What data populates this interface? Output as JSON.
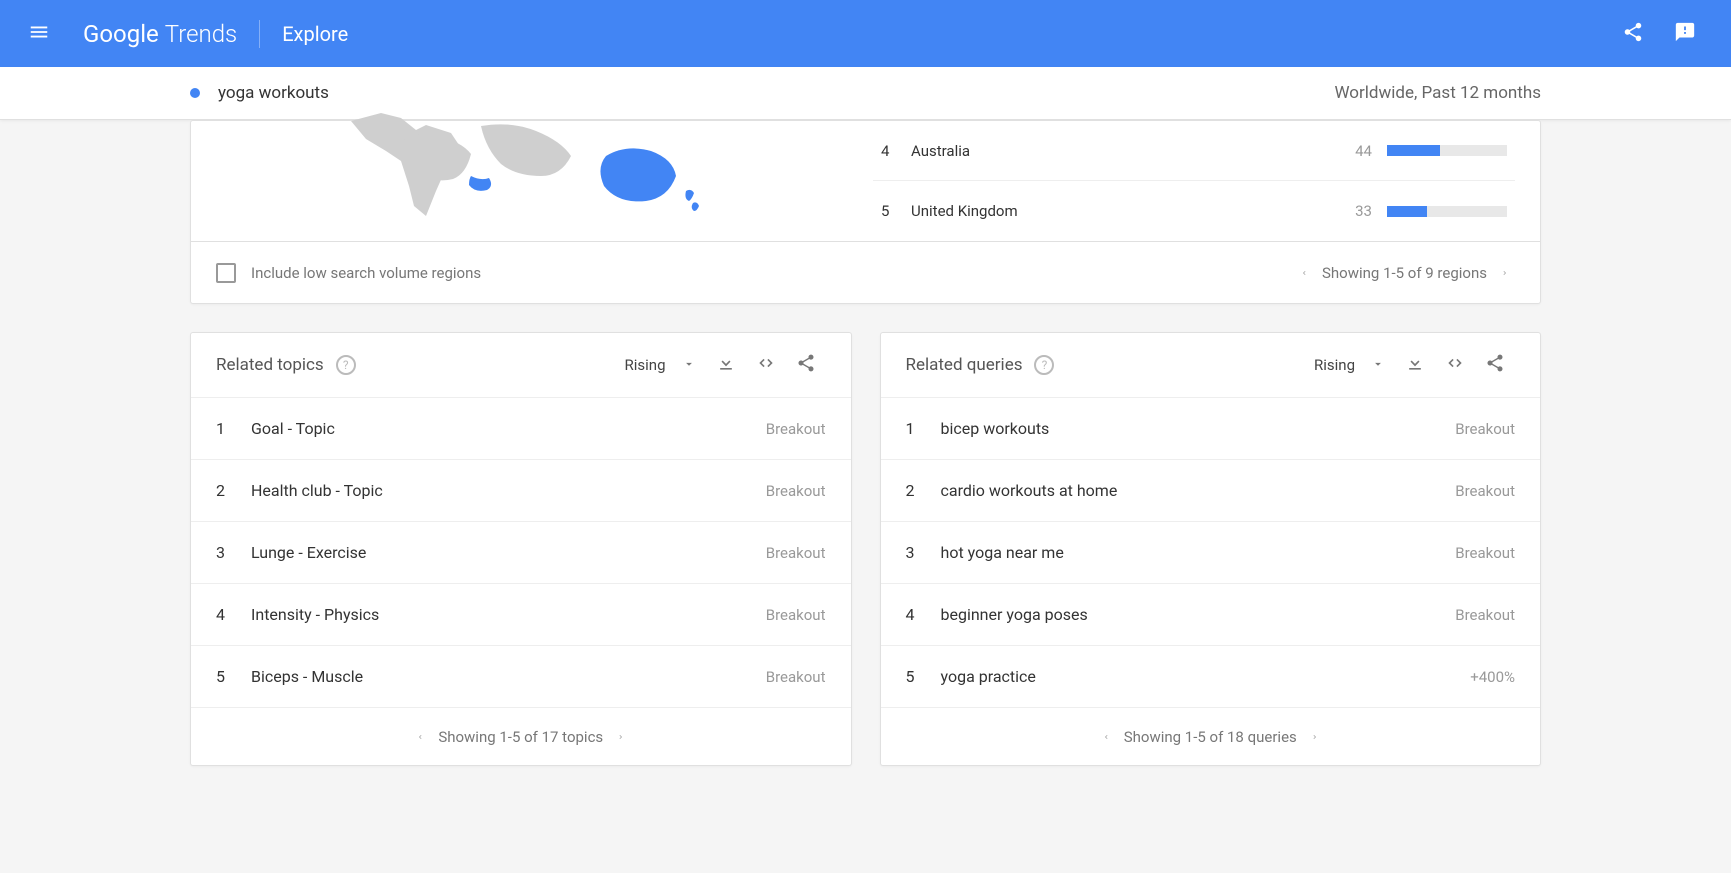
{
  "header": {
    "logo_google": "Google",
    "logo_trends": "Trends",
    "explore": "Explore"
  },
  "subheader": {
    "term": "yoga workouts",
    "context": "Worldwide, Past 12 months"
  },
  "regions_card": {
    "items": [
      {
        "rank": "4",
        "name": "Australia",
        "value": "44",
        "width": "44%"
      },
      {
        "rank": "5",
        "name": "United Kingdom",
        "value": "33",
        "width": "33%"
      }
    ],
    "checkbox_label": "Include low search volume regions",
    "pager": "Showing 1-5 of 9 regions"
  },
  "related_topics": {
    "title": "Related topics",
    "sort": "Rising",
    "items": [
      {
        "rank": "1",
        "label": "Goal - Topic",
        "value": "Breakout"
      },
      {
        "rank": "2",
        "label": "Health club - Topic",
        "value": "Breakout"
      },
      {
        "rank": "3",
        "label": "Lunge - Exercise",
        "value": "Breakout"
      },
      {
        "rank": "4",
        "label": "Intensity - Physics",
        "value": "Breakout"
      },
      {
        "rank": "5",
        "label": "Biceps - Muscle",
        "value": "Breakout"
      }
    ],
    "pager": "Showing 1-5 of 17 topics"
  },
  "related_queries": {
    "title": "Related queries",
    "sort": "Rising",
    "items": [
      {
        "rank": "1",
        "label": "bicep workouts",
        "value": "Breakout"
      },
      {
        "rank": "2",
        "label": "cardio workouts at home",
        "value": "Breakout"
      },
      {
        "rank": "3",
        "label": "hot yoga near me",
        "value": "Breakout"
      },
      {
        "rank": "4",
        "label": "beginner yoga poses",
        "value": "Breakout"
      },
      {
        "rank": "5",
        "label": "yoga practice",
        "value": "+400%"
      }
    ],
    "pager": "Showing 1-5 of 18 queries"
  }
}
